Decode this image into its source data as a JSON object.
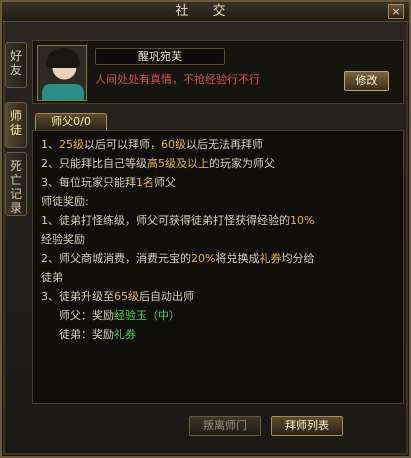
{
  "window": {
    "title": "社 交",
    "close_label": "×"
  },
  "side_tabs": [
    {
      "label": "好友"
    },
    {
      "label": "师徒"
    },
    {
      "label": "死亡记录"
    }
  ],
  "profile": {
    "name": "醒巩宛芙",
    "signature": "人间处处有真情，不抢经验行不行",
    "modify_label": "修改"
  },
  "subtab": {
    "label": "师父0/0"
  },
  "rules": {
    "l1": [
      "1、",
      "25级",
      "以后可以拜师，",
      "60级",
      "以后无法再拜师"
    ],
    "l2": [
      "2、只能拜比自己等级",
      "高5级及以上",
      "的玩家为师父"
    ],
    "l3": [
      "3、每位玩家只能拜",
      "1名",
      "师父"
    ],
    "l4": "师徒奖励:",
    "l5": [
      "1、徒弟打怪练级，师父可获得徒弟打怪获得经验的",
      "10%"
    ],
    "l6": "经验奖励",
    "l7": [
      "2、师父商城消费，消费元宝的",
      "20%",
      "将兑换成",
      "礼券",
      "均分给"
    ],
    "l8": "徒弟",
    "l9": [
      "3、徒弟升级至",
      "65级",
      "后自动出师"
    ],
    "l10": [
      "师父：奖励",
      "经验玉（中）"
    ],
    "l11": [
      "徒弟：奖励",
      "礼券"
    ]
  },
  "buttons": {
    "leave_label": "叛离师门",
    "list_label": "拜师列表"
  },
  "colors": {
    "highlight": "#e8b63a",
    "reward": "#4ed24a",
    "signature": "#d9504a"
  }
}
